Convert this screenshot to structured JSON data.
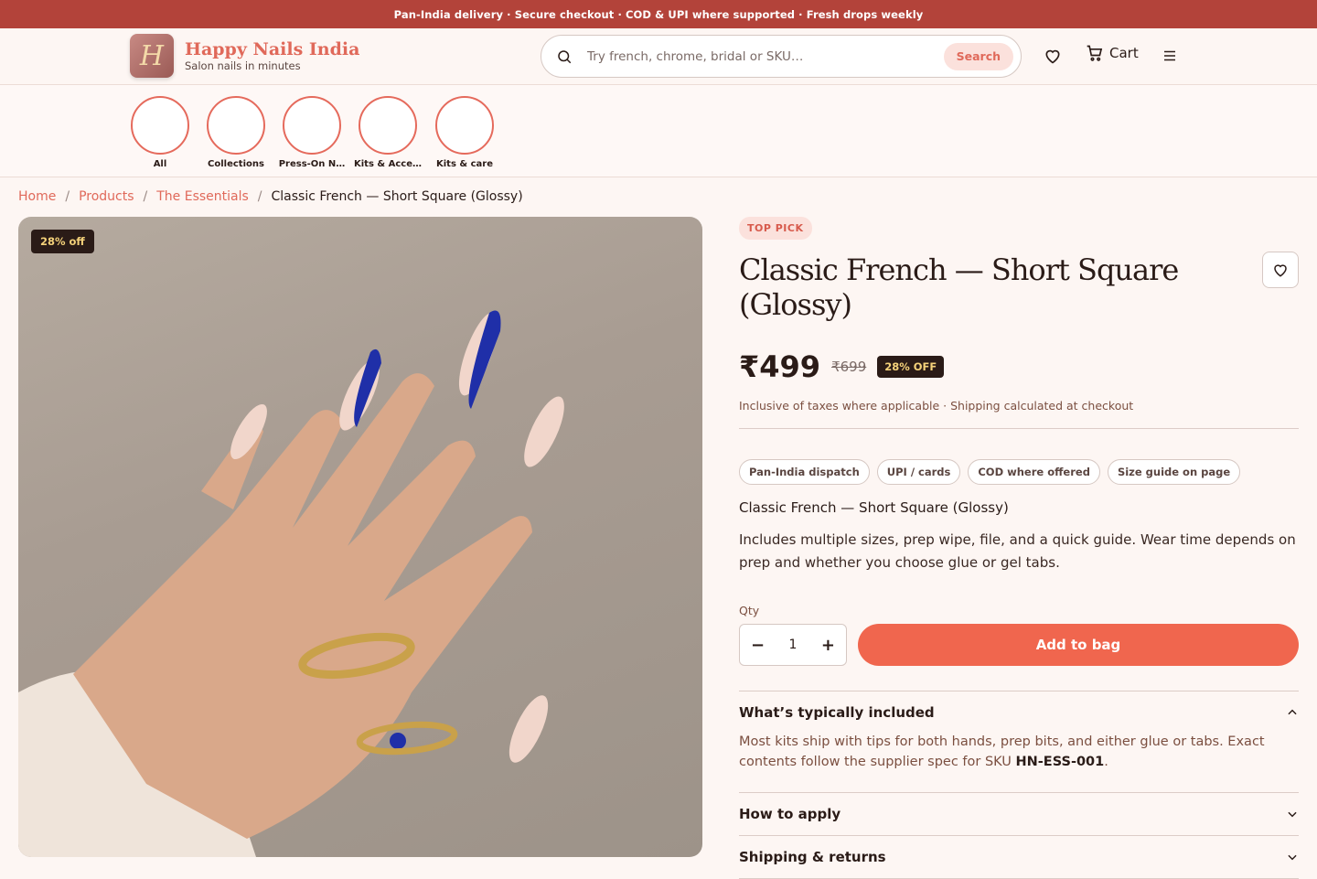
{
  "announcement": "Pan-India delivery · Secure checkout · COD & UPI where supported · Fresh drops weekly",
  "brand": {
    "logo_letter": "H",
    "name": "Happy Nails India",
    "tagline": "Salon nails in minutes"
  },
  "search": {
    "placeholder": "Try french, chrome, bridal or SKU…",
    "button": "Search"
  },
  "header": {
    "cart_label": "Cart"
  },
  "categories": [
    "All",
    "Collections",
    "Press-On N…",
    "Kits & Acce…",
    "Kits & care"
  ],
  "breadcrumb": {
    "home": "Home",
    "products": "Products",
    "collection": "The Essentials",
    "current": "Classic French — Short Square (Glossy)",
    "separator": "/"
  },
  "photo": {
    "badge": "28% off"
  },
  "product": {
    "tag": "TOP PICK",
    "title": "Classic French — Short Square (Glossy)",
    "price": "₹499",
    "compare_price": "₹699",
    "discount": "28% OFF",
    "tax_note": "Inclusive of taxes where applicable · Shipping calculated at checkout",
    "chips": [
      "Pan-India dispatch",
      "UPI / cards",
      "COD where offered",
      "Size guide on page"
    ],
    "subtitle": "Classic French — Short Square (Glossy)",
    "description": "Includes multiple sizes, prep wipe, file, and a quick guide. Wear time depends on prep and whether you choose glue or gel tabs.",
    "qty_label": "Qty",
    "qty_value": "1",
    "qty_minus": "−",
    "qty_plus": "+",
    "add_button": "Add to bag"
  },
  "accordion": {
    "included": {
      "title": "What’s typically included",
      "body_prefix": "Most kits ship with tips for both hands, prep bits, and either glue or tabs. Exact contents follow the supplier spec for SKU ",
      "sku": "HN-ESS-001",
      "body_suffix": "."
    },
    "apply": {
      "title": "How to apply"
    },
    "shipping": {
      "title": "Shipping & returns"
    }
  },
  "colors": {
    "accent": "#f0664e",
    "banner": "#b3433a",
    "dark": "#2a1b17",
    "badge_text": "#f5d27a"
  }
}
